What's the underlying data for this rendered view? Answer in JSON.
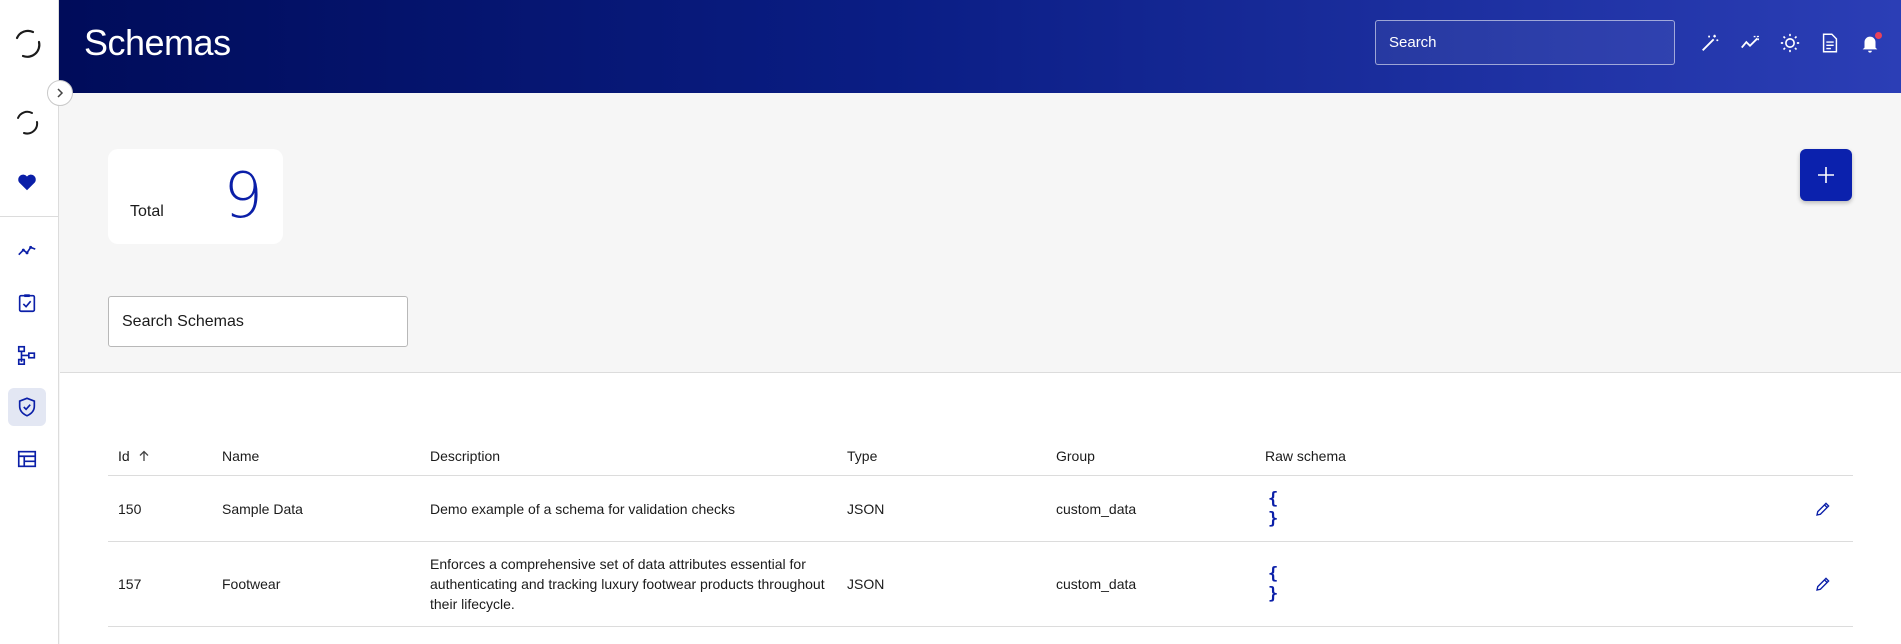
{
  "header": {
    "title": "Schemas",
    "search_placeholder": "Search",
    "icons": [
      "magic-wand-icon",
      "trend-icon",
      "sun-icon",
      "document-icon",
      "bell-icon"
    ]
  },
  "sidebar": {
    "items": [
      {
        "name": "logo-icon"
      },
      {
        "name": "loader-icon"
      },
      {
        "name": "heart-icon"
      },
      {
        "name": "chart-line-icon"
      },
      {
        "name": "clipboard-check-icon"
      },
      {
        "name": "hierarchy-icon"
      },
      {
        "name": "shield-check-icon",
        "active": true
      },
      {
        "name": "table-icon"
      }
    ]
  },
  "summary": {
    "total_label": "Total",
    "total_value": "9"
  },
  "filter": {
    "search_placeholder": "Search Schemas"
  },
  "table": {
    "columns": {
      "id": "Id",
      "name": "Name",
      "description": "Description",
      "type": "Type",
      "group": "Group",
      "raw_schema": "Raw schema"
    },
    "rows": [
      {
        "id": "150",
        "name": "Sample Data",
        "description": "Demo example of a schema for validation checks",
        "type": "JSON",
        "group": "custom_data",
        "raw_icon": "{ }"
      },
      {
        "id": "157",
        "name": "Footwear",
        "description": "Enforces a comprehensive set of data attributes essential for authenticating and tracking luxury footwear products throughout their lifecycle.",
        "type": "JSON",
        "group": "custom_data",
        "raw_icon": "{ }"
      }
    ]
  },
  "colors": {
    "accent": "#0b1fa8",
    "header_start": "#000c5a",
    "header_end": "#2b3eb6",
    "notification": "#e8425a"
  }
}
